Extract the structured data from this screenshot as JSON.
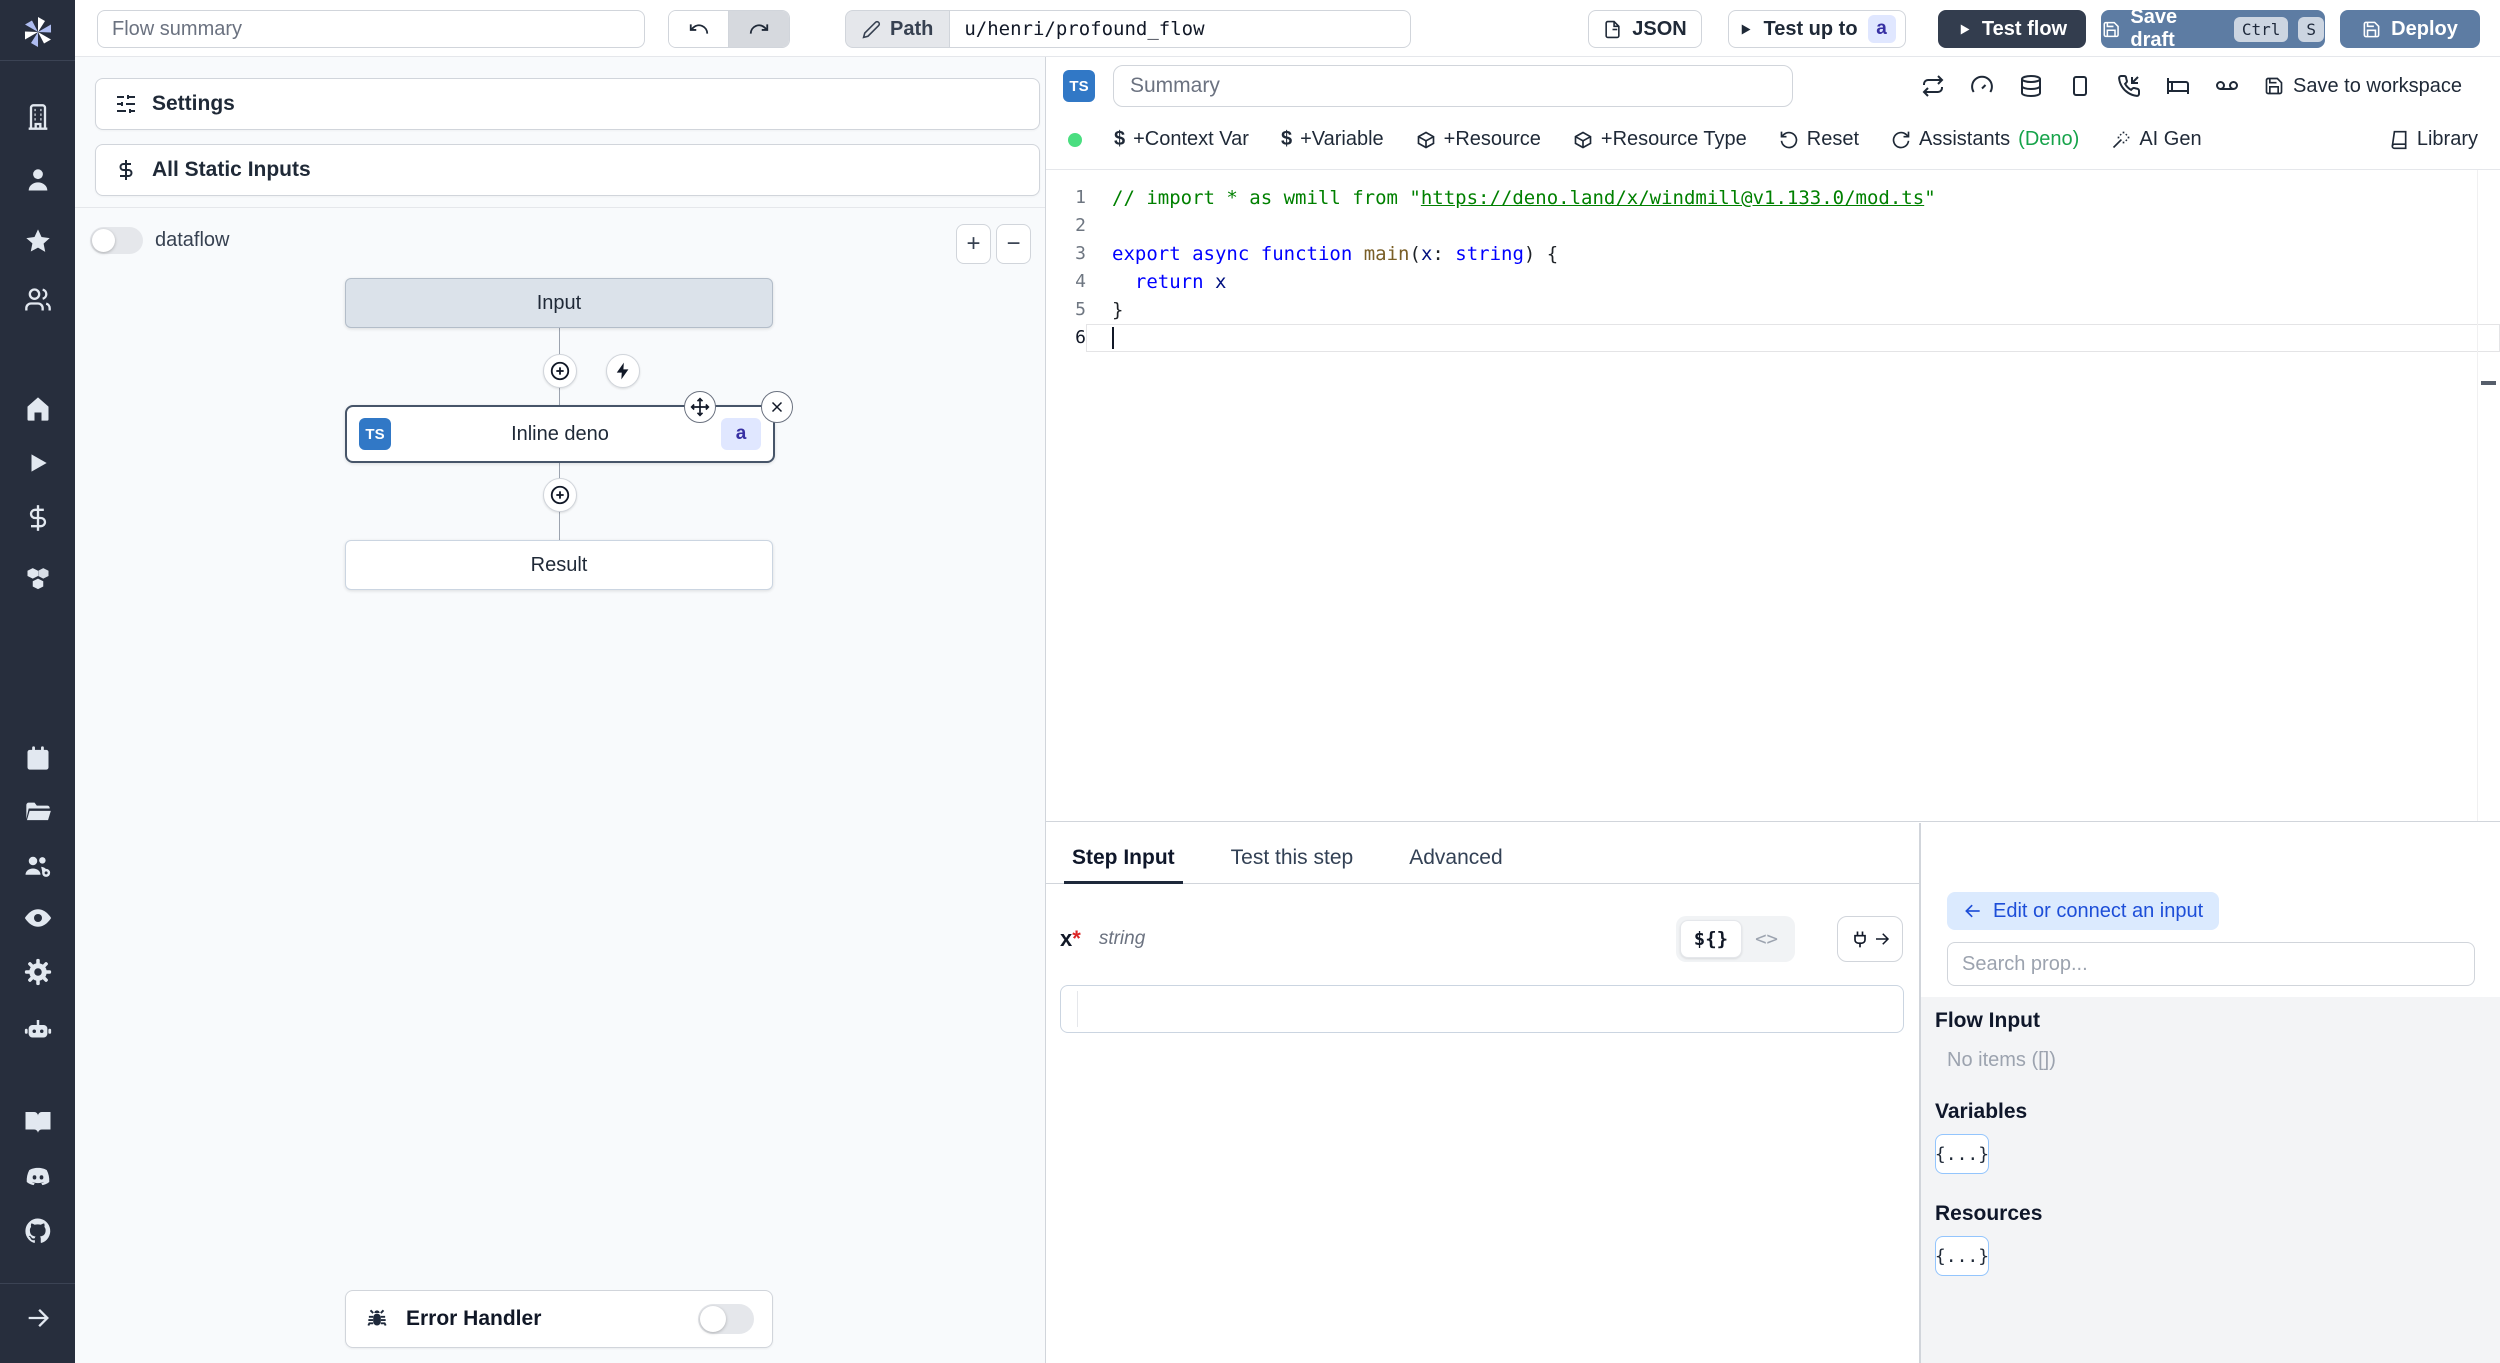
{
  "topbar": {
    "flow_summary_placeholder": "Flow summary",
    "path_label": "Path",
    "path_value": "u/henri/profound_flow",
    "json_label": "JSON",
    "test_up_to_label": "Test up to",
    "test_up_to_badge": "a",
    "test_flow_label": "Test flow",
    "save_draft_label": "Save draft",
    "kbd_ctrl": "Ctrl",
    "kbd_s": "S",
    "deploy_label": "Deploy"
  },
  "sidebar": {
    "icons": [
      "windmill-logo",
      "building",
      "user",
      "star",
      "users",
      "home",
      "play",
      "dollar",
      "boxes",
      "calendar",
      "folder",
      "users-cog",
      "eye",
      "gear",
      "bot",
      "book",
      "discord",
      "github",
      "expand-arrow"
    ]
  },
  "flow_panel": {
    "settings_label": "Settings",
    "static_inputs_label": "All Static Inputs",
    "dataflow_label": "dataflow",
    "zoom_in_label": "+",
    "zoom_out_label": "−",
    "nodes": {
      "input_label": "Input",
      "step_label": "Inline deno",
      "step_lang_badge": "TS",
      "step_id_badge": "a",
      "result_label": "Result"
    },
    "error_handler_label": "Error Handler"
  },
  "editor": {
    "lang_badge": "TS",
    "summary_placeholder": "Summary",
    "save_to_workspace_label": "Save to workspace",
    "toolbar": {
      "context_var": "+Context Var",
      "variable": "+Variable",
      "resource": "+Resource",
      "resource_type": "+Resource Type",
      "reset": "Reset",
      "assistants": "Assistants",
      "assistants_lang": "(Deno)",
      "ai_gen": "AI Gen",
      "library": "Library"
    },
    "code": {
      "active_line": 6,
      "lines": [
        [
          [
            "comment",
            "// import * as wmill from \""
          ],
          [
            "link",
            "https://deno.land/x/windmill@v1.133.0/mod.ts"
          ],
          [
            "comment",
            "\""
          ]
        ],
        [],
        [
          [
            "kw",
            "export"
          ],
          [
            "plain",
            " "
          ],
          [
            "kw",
            "async"
          ],
          [
            "plain",
            " "
          ],
          [
            "kw",
            "function"
          ],
          [
            "plain",
            " "
          ],
          [
            "fn",
            "main"
          ],
          [
            "plain",
            "("
          ],
          [
            "vr",
            "x"
          ],
          [
            "plain",
            ": "
          ],
          [
            "kw",
            "string"
          ],
          [
            "plain",
            ") {"
          ]
        ],
        [
          [
            "plain",
            "  "
          ],
          [
            "kw",
            "return"
          ],
          [
            "plain",
            " "
          ],
          [
            "vr",
            "x"
          ]
        ],
        [
          [
            "plain",
            "}"
          ]
        ],
        []
      ]
    }
  },
  "step_panel": {
    "tabs": [
      "Step Input",
      "Test this step",
      "Advanced"
    ],
    "active_tab": "Step Input",
    "field_name": "x",
    "field_required_mark": "*",
    "field_type": "string",
    "template_toggle_label": "${}",
    "code_toggle_label": "<>"
  },
  "prop_panel": {
    "back_label": "Edit or connect an input",
    "search_placeholder": "Search prop...",
    "flow_input_title": "Flow Input",
    "flow_input_empty": "No items ([])",
    "variables_title": "Variables",
    "variables_chip": "{...}",
    "resources_title": "Resources",
    "resources_chip": "{...}"
  },
  "colors": {
    "ts_badge": "#3178c6",
    "badge_indigo_bg": "#e0e7ff",
    "badge_indigo_text": "#3730a3",
    "save_button_slate": "#5d7ca3",
    "test_flow_dark": "#333d4e",
    "deno_green": "#16a34a",
    "status_green": "#4ade80",
    "accent_blue": "#1d4ed8",
    "sidebar_bg": "#272e3d"
  }
}
